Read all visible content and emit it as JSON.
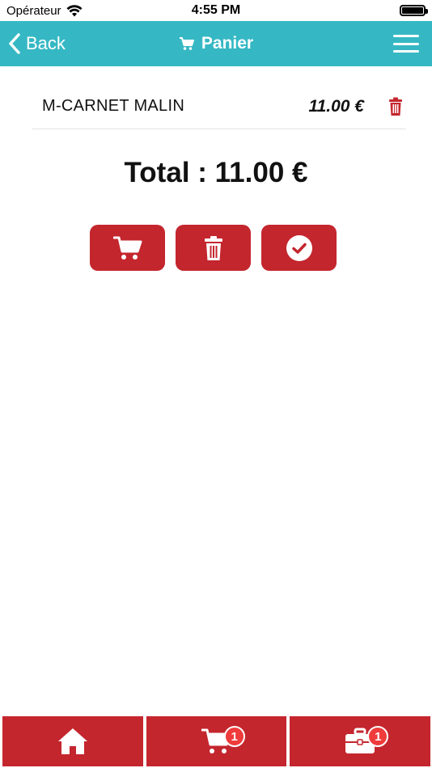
{
  "status_bar": {
    "carrier": "Opérateur",
    "time": "4:55 PM"
  },
  "navbar": {
    "back_label": "Back",
    "title": "Panier",
    "color": "#36b8c4"
  },
  "cart": {
    "items": [
      {
        "name": "M-CARNET MALIN",
        "price": "11.00 €"
      }
    ],
    "total": "Total : 11.00 €"
  },
  "actions": [
    {
      "name": "continue-shopping",
      "icon": "cart-icon"
    },
    {
      "name": "empty-cart",
      "icon": "trash-icon"
    },
    {
      "name": "validate-order",
      "icon": "check-circle-icon"
    }
  ],
  "tabbar": {
    "cart_badge": "1",
    "briefcase_badge": "1",
    "color": "#c4262e"
  }
}
